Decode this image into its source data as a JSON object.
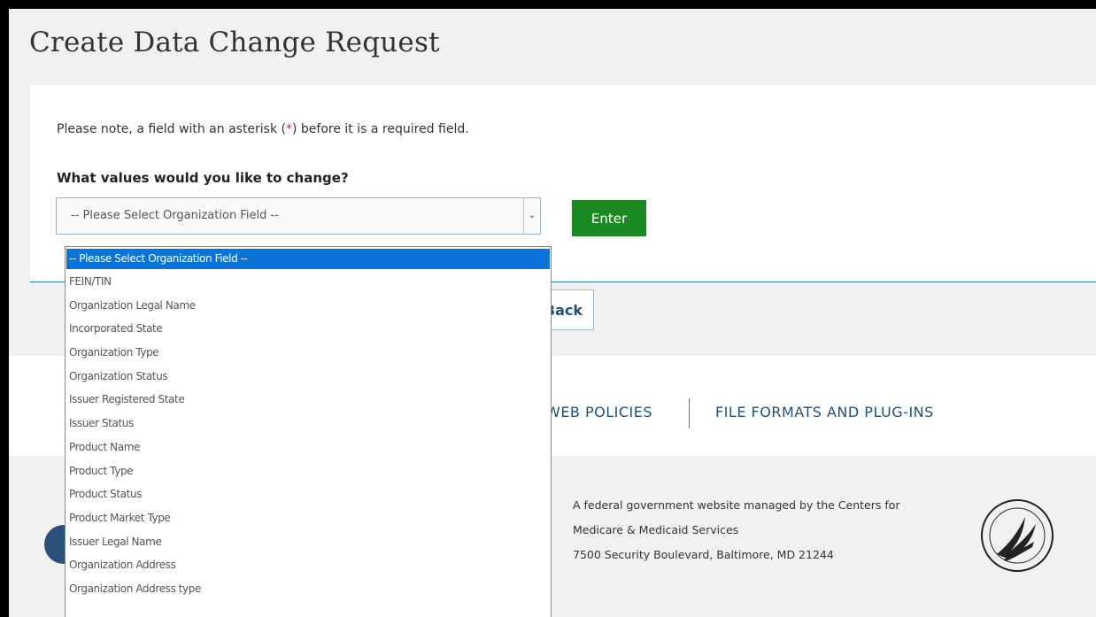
{
  "page": {
    "title": "Create Data Change Request",
    "note_before": "Please note, a field with an asterisk (",
    "note_star": "*",
    "note_after": ") before it is a required field.",
    "question": "What values would you like to change?"
  },
  "select": {
    "value": "-- Please Select Organization Field --",
    "options": [
      "-- Please Select Organization Field --",
      "FEIN/TIN",
      "Organization Legal Name",
      "Incorporated State",
      "Organization Type",
      "Organization Status",
      "Issuer Registered State",
      "Issuer Status",
      "Product Name",
      "Product Type",
      "Product Status",
      "Product Market Type",
      "Issuer Legal Name",
      "Organization Address",
      "Organization Address type"
    ]
  },
  "buttons": {
    "enter": "Enter",
    "back": "Back"
  },
  "nav": {
    "web_policies": "WEB POLICIES",
    "file_formats": "FILE FORMATS AND PLUG-INS"
  },
  "footer": {
    "line1": "A federal government website managed by the Centers for",
    "line2": "Medicare & Medicaid Services",
    "line3": "7500 Security Boulevard, Baltimore, MD 21244"
  },
  "icons": {
    "dropdown_arrow": "chevron-down-icon",
    "seal": "hhs-seal-icon",
    "logo": "agency-logo-icon"
  },
  "colors": {
    "accent": "#2a77b5",
    "enter_button": "#1b8a23",
    "selected_option": "#0a74da",
    "required_star": "#c0392b"
  }
}
